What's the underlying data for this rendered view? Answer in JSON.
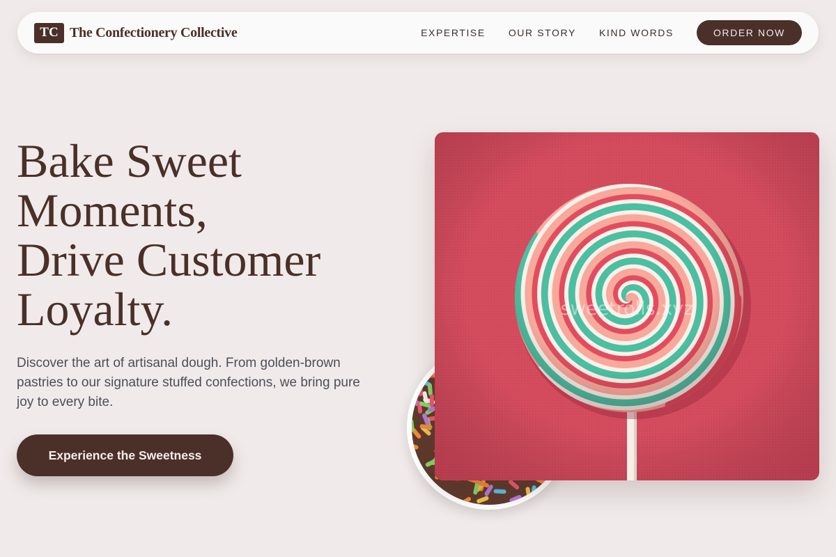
{
  "nav": {
    "brand_mark": "TC",
    "brand_name": "The Confectionery Collective",
    "links": [
      {
        "label": "EXPERTISE"
      },
      {
        "label": "OUR STORY"
      },
      {
        "label": "KIND WORDS"
      }
    ],
    "cta_label": "ORDER NOW"
  },
  "hero": {
    "title_lines": [
      "Bake Sweet",
      "Moments,",
      "Drive Customer",
      "Loyalty."
    ],
    "description": "Discover the art of artisanal dough. From golden-brown pastries to our signature stuffed confections, we bring pure joy to every bite.",
    "cta_label": "Experience the Sweetness"
  },
  "images": {
    "main_photo_watermark": "sweetrolls.xyz",
    "main_photo_subject": "swirl-lollipop",
    "circle_photo_subject": "sugar-sprinkles"
  },
  "colors": {
    "brand": "#4a3029",
    "background": "#f0ebea",
    "photo_background": "#d44d5f",
    "lollipop_red": "#e14d5e",
    "lollipop_green": "#4bbfa1",
    "lollipop_pink": "#f7a99c",
    "lollipop_white": "#fbf1ea"
  }
}
